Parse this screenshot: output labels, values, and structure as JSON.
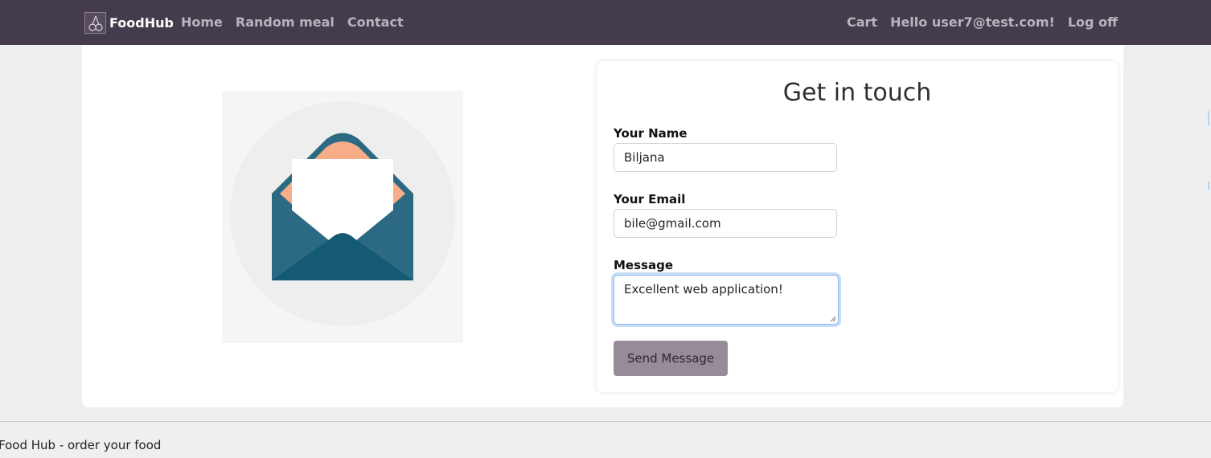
{
  "navbar": {
    "brand": "FoodHub",
    "left_links": [
      "Home",
      "Random meal",
      "Contact"
    ],
    "cart": "Cart",
    "greeting": "Hello user7@test.com!",
    "logoff": "Log off"
  },
  "contact": {
    "title": "Get in touch",
    "name_label": "Your Name",
    "name_value": "Biljana",
    "email_label": "Your Email",
    "email_value": "bile@gmail.com",
    "message_label": "Message",
    "message_value": "Excellent web application!",
    "send_label": "Send Message"
  },
  "footer": {
    "text": "Food Hub - order your food"
  },
  "colors": {
    "navbar": "#443c4c",
    "send_button": "#978a99",
    "envelope_dark": "#155a73",
    "envelope_light": "#2b6a82",
    "envelope_inner": "#f7ad87"
  },
  "icons": [
    "cherry-logo-icon",
    "open-envelope-illustration"
  ]
}
